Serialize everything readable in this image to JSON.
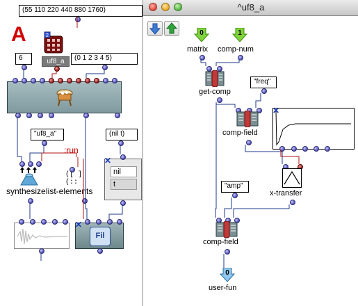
{
  "left_patch": {
    "top_list": "(55 110 220 440 880 1760)",
    "red_label": "A",
    "num_6": "6",
    "list_range": "(0 1 2 3 4 5)",
    "instance_label": "uf8_a",
    "string_uf8": "\"uf8_a\"",
    "run_label": ":run",
    "synthesize_label": "synthesize",
    "list_elements_label": "list-elements",
    "nil_t_box": "(nil t)",
    "menu_options": [
      "nil",
      "t"
    ],
    "file_label": "Fil"
  },
  "window": {
    "title": "^uf8_a",
    "inputs": [
      {
        "value": "0",
        "label": "matrix"
      },
      {
        "value": "1",
        "label": "comp-num"
      }
    ],
    "get_comp_label": "get-comp",
    "freq_box": "\"freq\"",
    "comp_field_label_1": "comp-field",
    "amp_box": "\"amp\"",
    "x_transfer_label": "x-transfer",
    "comp_field_label_2": "comp-field",
    "output": {
      "value": "0",
      "label": "user-fun"
    }
  },
  "colors": {
    "wire": "#1f3a8a",
    "red_wire": "#b01010",
    "red_text": "#d00000"
  },
  "icons": [
    "down-arrow-icon",
    "up-arrow-icon"
  ]
}
